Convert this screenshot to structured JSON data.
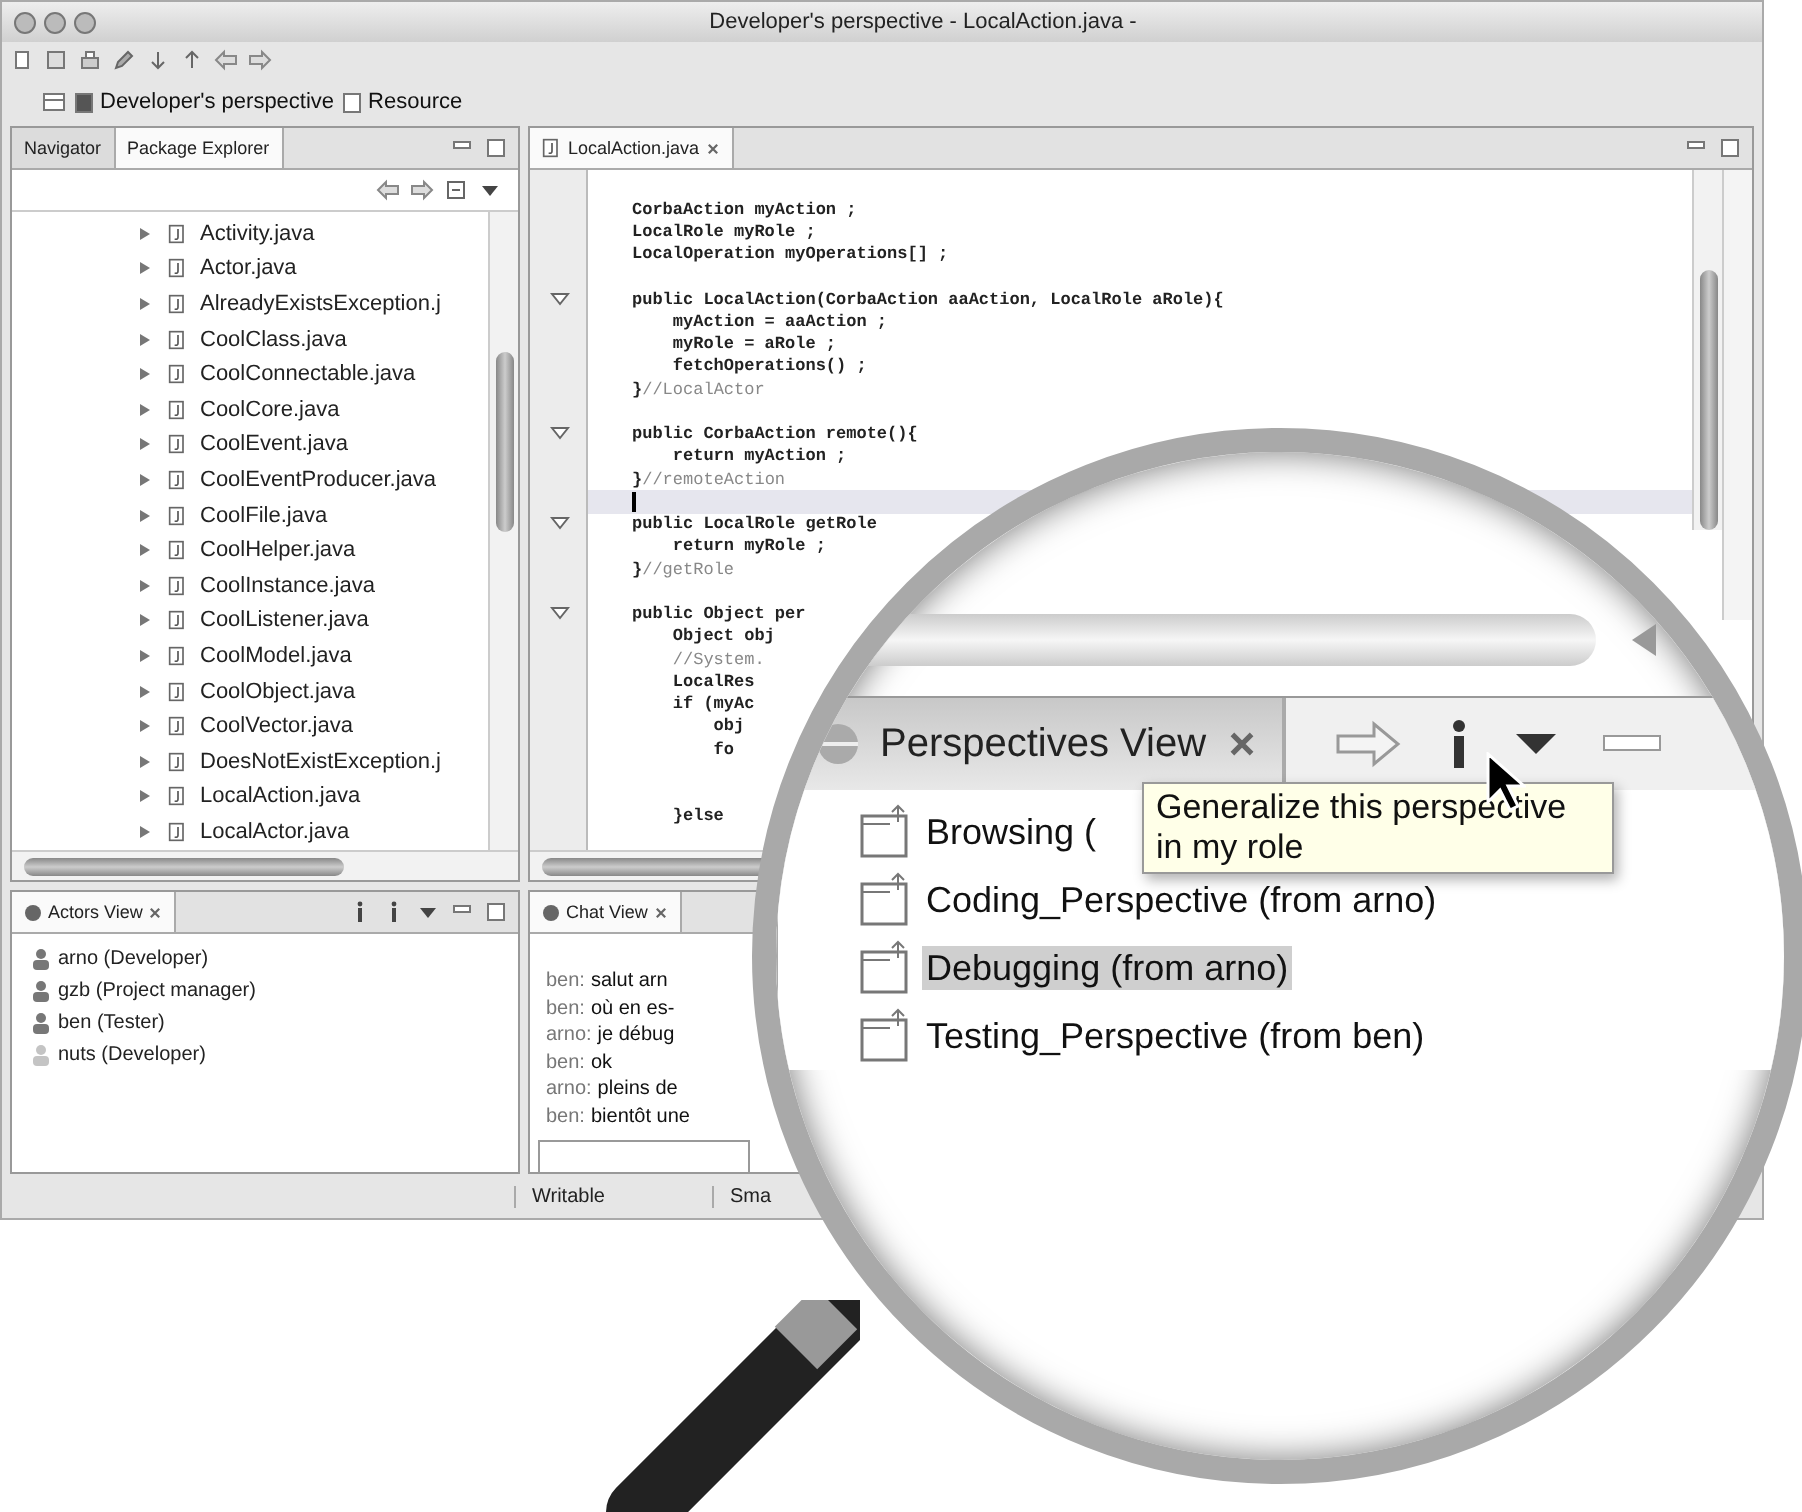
{
  "window": {
    "title": "Developer's perspective - LocalAction.java -"
  },
  "perspectives": [
    "Developer's perspective",
    "Resource"
  ],
  "explorer": {
    "tabs": [
      {
        "label": "Navigator",
        "selected": false
      },
      {
        "label": "Package Explorer",
        "selected": true
      }
    ],
    "files": [
      "Activity.java",
      "Actor.java",
      "AlreadyExistsException.j",
      "CoolClass.java",
      "CoolConnectable.java",
      "CoolCore.java",
      "CoolEvent.java",
      "CoolEventProducer.java",
      "CoolFile.java",
      "CoolHelper.java",
      "CoolInstance.java",
      "CoolListener.java",
      "CoolModel.java",
      "CoolObject.java",
      "CoolVector.java",
      "DoesNotExistException.j",
      "LocalAction.java",
      "LocalActor.java"
    ]
  },
  "editor": {
    "tab": "LocalAction.java",
    "lines": [
      {
        "code": "CorbaAction myAction ;",
        "fold": false,
        "current": false
      },
      {
        "code": "LocalRole myRole ;",
        "fold": false,
        "current": false
      },
      {
        "code": "LocalOperation myOperations[] ;",
        "fold": false,
        "current": false
      },
      {
        "fold": false,
        "current": false
      },
      {
        "code": "public LocalAction(CorbaAction aaAction, LocalRole aRole){",
        "fold": true,
        "current": false
      },
      {
        "code": "    myAction = aaAction ;",
        "fold": false,
        "current": false
      },
      {
        "code": "    myRole = aRole ;",
        "fold": false,
        "current": false
      },
      {
        "code": "    fetchOperations() ;",
        "fold": false,
        "current": false
      },
      {
        "code": "}",
        "comment": "//LocalActor",
        "fold": false,
        "current": false
      },
      {
        "fold": false,
        "current": false
      },
      {
        "code": "public CorbaAction remote(){",
        "fold": true,
        "current": false
      },
      {
        "code": "    return myAction ;",
        "fold": false,
        "current": false
      },
      {
        "code": "}",
        "comment": "//remoteAction",
        "fold": false,
        "current": false
      },
      {
        "fold": false,
        "current": true
      },
      {
        "code": "public LocalRole getRole",
        "fold": true,
        "current": false
      },
      {
        "code": "    return myRole ;",
        "fold": false,
        "current": false
      },
      {
        "code": "}",
        "comment": "//getRole",
        "fold": false,
        "current": false
      },
      {
        "fold": false,
        "current": false
      },
      {
        "code": "public Object per",
        "fold": true,
        "current": false
      },
      {
        "code": "    Object obj",
        "fold": false,
        "current": false
      },
      {
        "comment": "    //System.",
        "fold": false,
        "current": false
      },
      {
        "code": "    LocalRes",
        "fold": false,
        "current": false
      },
      {
        "code": "    if (myAc",
        "fold": false,
        "current": false
      },
      {
        "code": "        obj",
        "fold": false,
        "current": false
      },
      {
        "code": "        fo",
        "fold": false,
        "current": false
      },
      {
        "fold": false,
        "current": false
      },
      {
        "fold": false,
        "current": false
      },
      {
        "code": "    }else",
        "fold": false,
        "current": false
      }
    ]
  },
  "actors": {
    "title": "Actors View",
    "items": [
      {
        "name": "arno (Developer)",
        "online": true
      },
      {
        "name": "gzb (Project manager)",
        "online": true
      },
      {
        "name": "ben (Tester)",
        "online": true
      },
      {
        "name": "nuts (Developer)",
        "online": false
      }
    ]
  },
  "chat": {
    "title": "Chat View",
    "messages": [
      {
        "speaker": "ben:",
        "text": "salut arn"
      },
      {
        "speaker": "ben:",
        "text": "où en es-"
      },
      {
        "speaker": "arno:",
        "text": "je débug"
      },
      {
        "speaker": "ben:",
        "text": "ok"
      },
      {
        "speaker": "arno:",
        "text": "pleins de"
      },
      {
        "speaker": "ben:",
        "text": "bientôt une"
      }
    ]
  },
  "status_bar": [
    "Writable",
    "Sma"
  ],
  "magnifier": {
    "title": "Perspectives View",
    "items": [
      {
        "label": "Browsing (",
        "selected": false
      },
      {
        "label": "Coding_Perspective (from arno)",
        "selected": false
      },
      {
        "label": "Debugging (from arno)",
        "selected": true
      },
      {
        "label": "Testing_Perspective (from ben)",
        "selected": false
      }
    ],
    "tooltip": "Generalize this perspective in my role"
  }
}
